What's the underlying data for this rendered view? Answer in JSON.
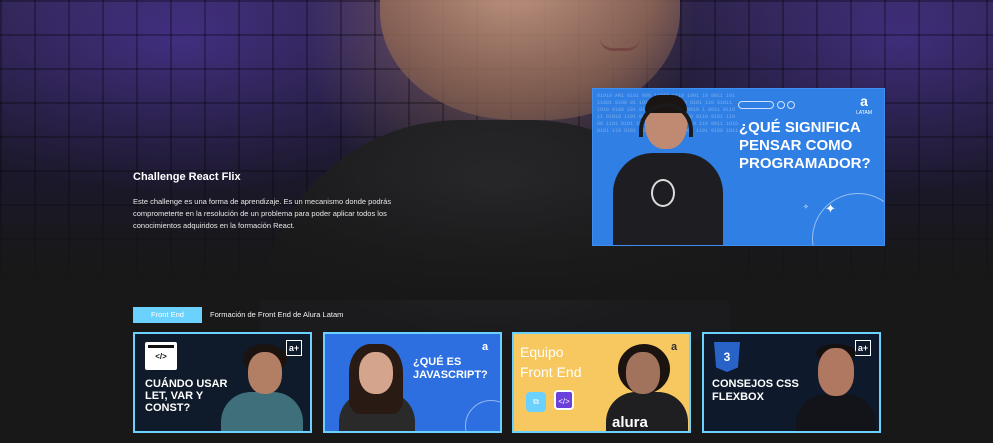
{
  "hero": {
    "title": "Challenge React Flix",
    "description": "Este challenge es una forma de aprendizaje. Es un mecanismo donde podrás comprometerte en la resolución de un problema para poder aplicar todos los conocimientos adquiridos en la formación React."
  },
  "featured_video": {
    "title": "¿QUÉ SIGNIFICA PENSAR COMO PROGRAMADOR?",
    "brand": "a",
    "brand_sub": "LATAM"
  },
  "category": {
    "badge": "Front End",
    "description": "Formación de Front End de Alura Latam",
    "accent": "#6bd1ff"
  },
  "cards": [
    {
      "title": "CUÁNDO USAR LET, VAR Y CONST?",
      "icon_text": "</>",
      "logo": "a+"
    },
    {
      "title": "¿QUÉ ES JAVASCRIPT?",
      "logo": "a"
    },
    {
      "title": "Equipo Front End",
      "logo": "a",
      "shirt_text": "alura"
    },
    {
      "title": "CONSEJOS CSS FLEXBOX",
      "icon_text": "3",
      "logo": "a+"
    }
  ]
}
